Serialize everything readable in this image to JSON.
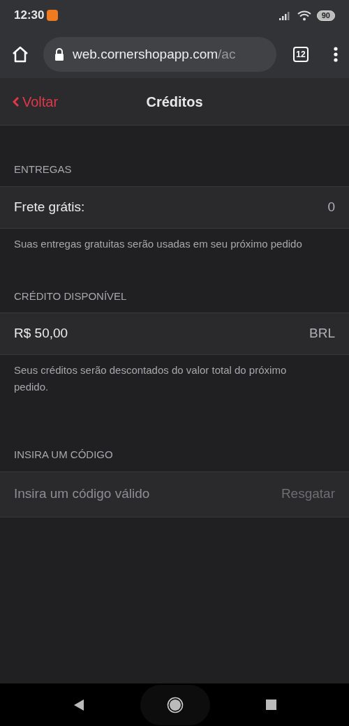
{
  "status_bar": {
    "time": "12:30",
    "battery": "90"
  },
  "browser": {
    "url_host": "web.cornershopapp.com",
    "url_path": "/ac",
    "tab_count": "12"
  },
  "header": {
    "back": "Voltar",
    "title": "Créditos"
  },
  "sections": [
    {
      "kind": "value",
      "title": "ENTREGAS",
      "label": "Frete grátis:",
      "value": "0",
      "note": "Suas entregas gratuitas serão usadas em seu próximo pedido"
    },
    {
      "kind": "value",
      "title": "CRÉDITO DISPONÍVEL",
      "label": "R$ 50,00",
      "value": "BRL",
      "note": "Seus créditos serão descontados do valor total do próximo pedido."
    },
    {
      "kind": "code",
      "title": "INSIRA UM CÓDIGO",
      "placeholder": "Insira um código válido",
      "action": "Resgatar",
      "disabled": true
    }
  ]
}
